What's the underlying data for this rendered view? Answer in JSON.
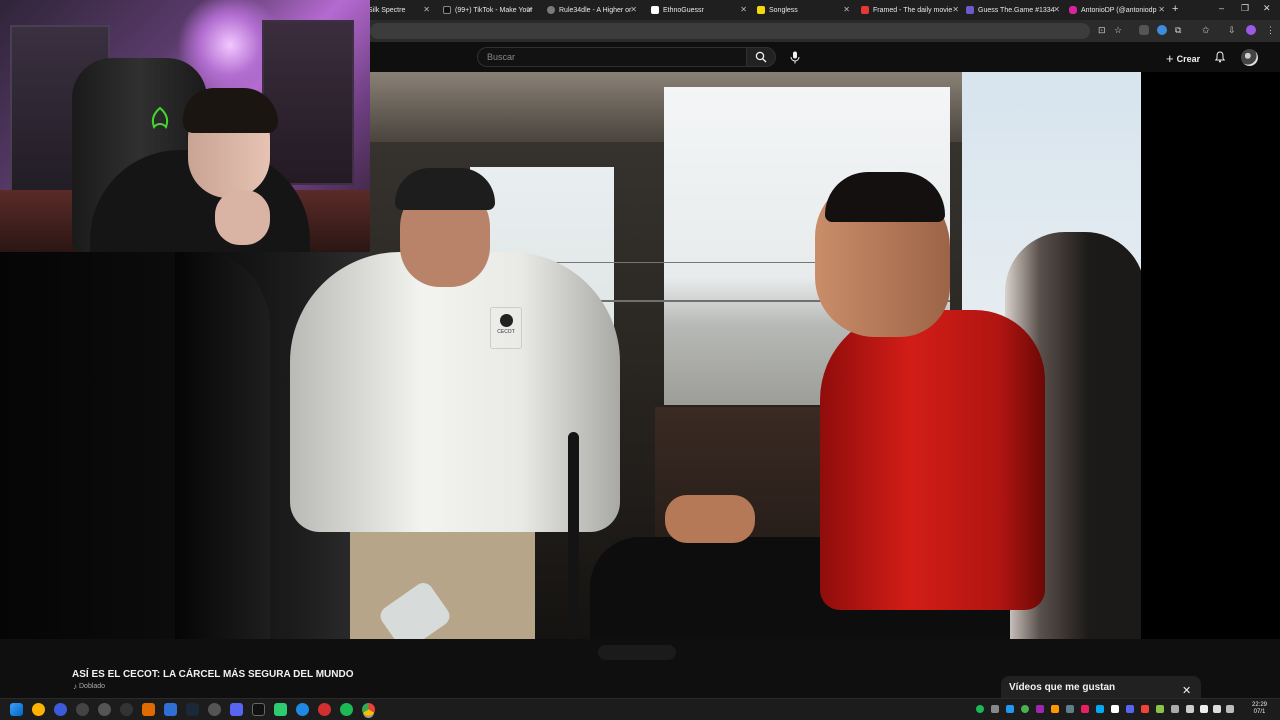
{
  "browser": {
    "tabs": [
      {
        "label": "Silk Spectre",
        "fav": "#ff5d8f"
      },
      {
        "label": "(99+) TikTok - Make Your",
        "fav": "#111111"
      },
      {
        "label": "Rule34dle - A Higher or",
        "fav": "#7a7a7a"
      },
      {
        "label": "EthnoGuessr",
        "fav": "#ffffff"
      },
      {
        "label": "Songless",
        "fav": "#f5d90a"
      },
      {
        "label": "Framed - The daily movie",
        "fav": "#e53935"
      },
      {
        "label": "Guess The.Game #1334",
        "fav": "#6a5acd"
      },
      {
        "label": "AntonioDP (@antoniodp",
        "fav": "#d6249f"
      }
    ],
    "new_tab": "+",
    "window_controls": {
      "minimize": "–",
      "maximize": "❐",
      "close": "✕"
    }
  },
  "youtube": {
    "search_placeholder": "Buscar",
    "create_label": "Crear",
    "video_title": "ASÍ ES EL CECOT: LA CÁRCEL MÁS SEGURA DEL MUNDO",
    "audio_track": "Doblado",
    "liked_panel": {
      "label": "Vídeos que me gustan",
      "close": "✕"
    },
    "shirt_logo": "CECOT"
  },
  "taskbar": {
    "time": "22:29",
    "date": "07/1"
  },
  "colors": {
    "accent_red": "#d31d17",
    "youtube_bg": "#0f0f0f"
  }
}
